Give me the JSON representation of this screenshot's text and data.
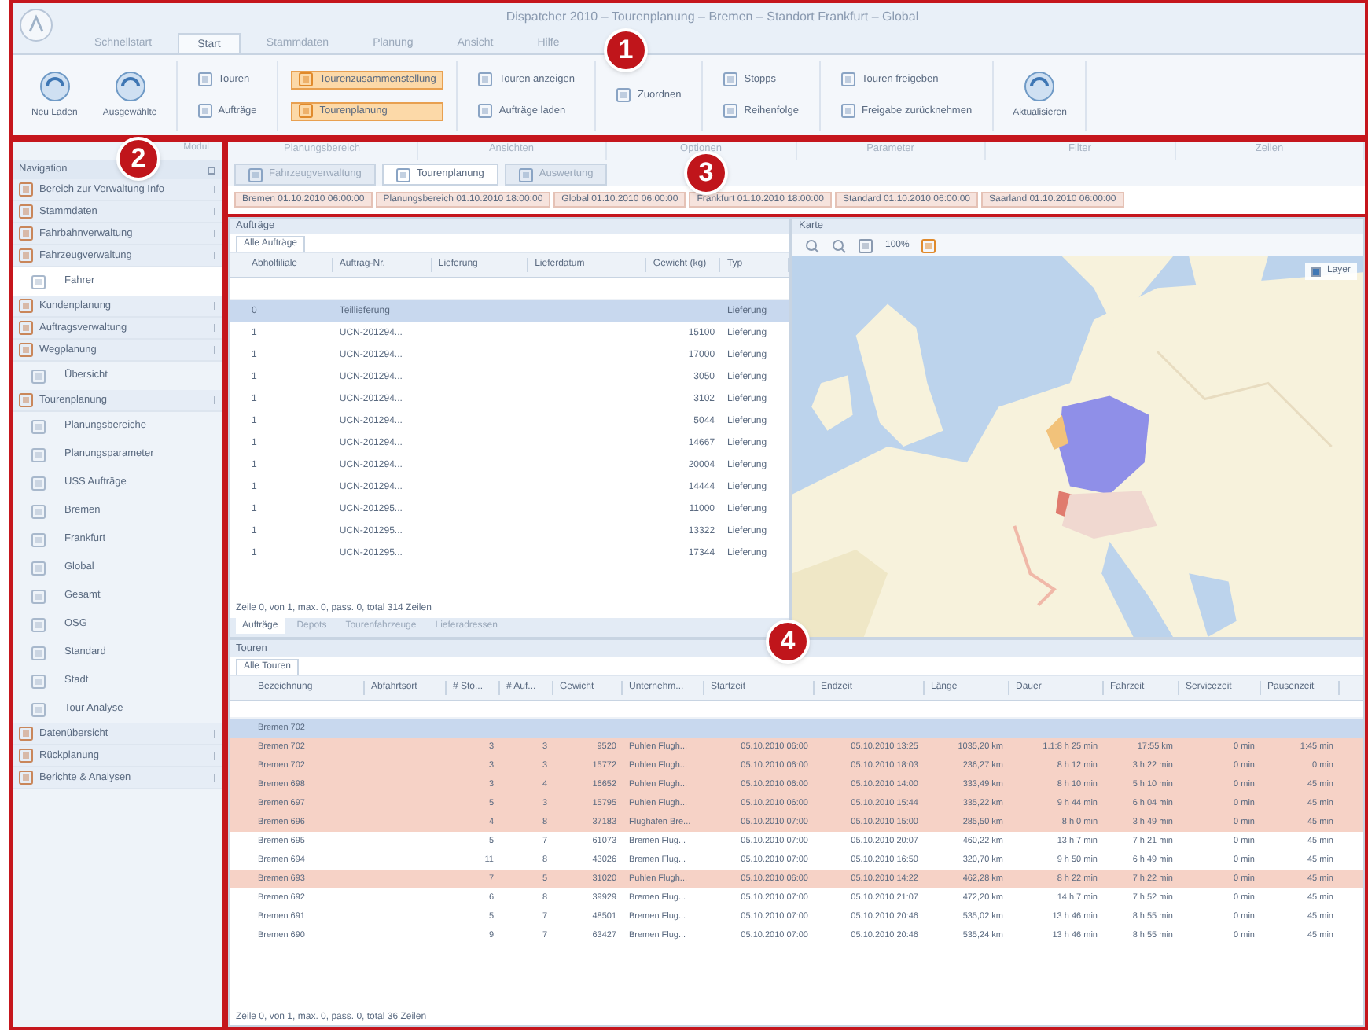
{
  "window": {
    "title": "Dispatcher 2010 – Tourenplanung – Bremen – Standort Frankfurt – Global"
  },
  "ribbon": {
    "marker": "1",
    "tabs": [
      {
        "label": "Schnellstart",
        "selected": false
      },
      {
        "label": "Start",
        "selected": true
      },
      {
        "label": "Stammdaten",
        "selected": false
      },
      {
        "label": "Planung",
        "selected": false
      },
      {
        "label": "Ansicht",
        "selected": false
      },
      {
        "label": "Hilfe",
        "selected": false
      }
    ],
    "groups": [
      {
        "items": [
          {
            "label": "Neu Laden",
            "kind": "large"
          },
          {
            "label": "Ausgewählte",
            "kind": "large"
          }
        ]
      },
      {
        "items": [
          {
            "label": "Touren",
            "kind": "small",
            "highlighted": false
          },
          {
            "label": "Aufträge",
            "kind": "small",
            "highlighted": false
          }
        ]
      },
      {
        "items": [
          {
            "label": "Tourenzusammenstellung",
            "kind": "small",
            "highlighted": true
          },
          {
            "label": "Tourenplanung",
            "kind": "small",
            "highlighted": true
          }
        ]
      },
      {
        "items": [
          {
            "label": "Touren anzeigen",
            "kind": "small",
            "highlighted": false
          },
          {
            "label": "Aufträge laden",
            "kind": "small",
            "highlighted": false
          }
        ]
      },
      {
        "items": [
          {
            "label": "Zuordnen",
            "kind": "small",
            "highlighted": false
          }
        ]
      },
      {
        "items": [
          {
            "label": "Stopps",
            "kind": "small",
            "highlighted": false
          },
          {
            "label": "Reihenfolge",
            "kind": "small",
            "highlighted": false
          }
        ]
      },
      {
        "items": [
          {
            "label": "Touren freigeben",
            "kind": "small",
            "highlighted": false
          },
          {
            "label": "Freigabe zurücknehmen",
            "kind": "small",
            "highlighted": false
          }
        ]
      },
      {
        "items": [
          {
            "label": "Aktualisieren",
            "kind": "large"
          }
        ]
      }
    ]
  },
  "navigation": {
    "marker": "2",
    "header": "Modul",
    "title": "Navigation",
    "items": [
      {
        "label": "Bereich zur Verwaltung Info",
        "kind": "section",
        "selected": false
      },
      {
        "label": "Stammdaten",
        "kind": "section",
        "selected": false
      },
      {
        "label": "Fahrbahnverwaltung",
        "kind": "section",
        "selected": false
      },
      {
        "label": "Fahrzeugverwaltung",
        "kind": "section",
        "selected": false
      },
      {
        "label": "Fahrer",
        "kind": "item",
        "selected": true
      },
      {
        "label": "Kundenplanung",
        "kind": "section",
        "selected": false
      },
      {
        "label": "Auftragsverwaltung",
        "kind": "section",
        "selected": false
      },
      {
        "label": "Wegplanung",
        "kind": "section",
        "selected": false
      },
      {
        "label": "Übersicht",
        "kind": "item",
        "selected": false
      },
      {
        "label": "Tourenplanung",
        "kind": "section",
        "selected": false
      },
      {
        "label": "Planungsbereiche",
        "kind": "item",
        "selected": false
      },
      {
        "label": "Planungsparameter",
        "kind": "item",
        "selected": false
      },
      {
        "label": "USS Aufträge",
        "kind": "item",
        "selected": false
      },
      {
        "label": "Bremen",
        "kind": "item",
        "selected": false
      },
      {
        "label": "Frankfurt",
        "kind": "item",
        "selected": false
      },
      {
        "label": "Global",
        "kind": "item",
        "selected": false
      },
      {
        "label": "Gesamt",
        "kind": "item",
        "selected": false
      },
      {
        "label": "OSG",
        "kind": "item",
        "selected": false
      },
      {
        "label": "Standard",
        "kind": "item",
        "selected": false
      },
      {
        "label": "Stadt",
        "kind": "item",
        "selected": false
      },
      {
        "label": "Tour Analyse",
        "kind": "item",
        "selected": false
      },
      {
        "label": "Datenübersicht",
        "kind": "section",
        "selected": false
      },
      {
        "label": "Rückplanung",
        "kind": "section",
        "selected": false
      },
      {
        "label": "Berichte & Analysen",
        "kind": "section",
        "selected": false
      }
    ]
  },
  "workspace": {
    "marker": "3",
    "groups": [
      "Planungsbereich",
      "Ansichten",
      "Optionen",
      "Parameter",
      "Filter",
      "Zeilen"
    ],
    "doc_tabs": [
      {
        "label": "Fahrzeugverwaltung",
        "selected": false
      },
      {
        "label": "Tourenplanung",
        "selected": true
      },
      {
        "label": "Auswertung",
        "selected": false
      }
    ],
    "filters": [
      "Bremen 01.10.2010 06:00:00",
      "Planungsbereich 01.10.2010 18:00:00",
      "Global 01.10.2010 06:00:00",
      "Frankfurt 01.10.2010 18:00:00",
      "Standard 01.10.2010 06:00:00",
      "Saarland 01.10.2010 06:00:00"
    ]
  },
  "panels_marker": "4",
  "orders_panel": {
    "title": "Aufträge",
    "filter_tab": "Alle Aufträge",
    "columns": [
      "Abholfiliale",
      "Auftrag-Nr.",
      "Lieferung",
      "Lieferdatum",
      "Gewicht (kg)",
      "Typ"
    ],
    "rows": [
      {
        "cells": [
          "0",
          "Teillieferung",
          "",
          "",
          "",
          "Lieferung"
        ],
        "selected": true
      },
      {
        "cells": [
          "1",
          "UCN-201294...",
          "",
          "",
          "15100",
          "Lieferung"
        ],
        "selected": false
      },
      {
        "cells": [
          "1",
          "UCN-201294...",
          "",
          "",
          "17000",
          "Lieferung"
        ],
        "selected": false
      },
      {
        "cells": [
          "1",
          "UCN-201294...",
          "",
          "",
          "3050",
          "Lieferung"
        ],
        "selected": false
      },
      {
        "cells": [
          "1",
          "UCN-201294...",
          "",
          "",
          "3102",
          "Lieferung"
        ],
        "selected": false
      },
      {
        "cells": [
          "1",
          "UCN-201294...",
          "",
          "",
          "5044",
          "Lieferung"
        ],
        "selected": false
      },
      {
        "cells": [
          "1",
          "UCN-201294...",
          "",
          "",
          "14667",
          "Lieferung"
        ],
        "selected": false
      },
      {
        "cells": [
          "1",
          "UCN-201294...",
          "",
          "",
          "20004",
          "Lieferung"
        ],
        "selected": false
      },
      {
        "cells": [
          "1",
          "UCN-201294...",
          "",
          "",
          "14444",
          "Lieferung"
        ],
        "selected": false
      },
      {
        "cells": [
          "1",
          "UCN-201295...",
          "",
          "",
          "11000",
          "Lieferung"
        ],
        "selected": false
      },
      {
        "cells": [
          "1",
          "UCN-201295...",
          "",
          "",
          "13322",
          "Lieferung"
        ],
        "selected": false
      },
      {
        "cells": [
          "1",
          "UCN-201295...",
          "",
          "",
          "17344",
          "Lieferung"
        ],
        "selected": false
      }
    ],
    "footer": "Zeile 0, von 1, max. 0, pass. 0, total 314 Zeilen",
    "bottom_tabs": [
      {
        "label": "Aufträge",
        "selected": true
      },
      {
        "label": "Depots",
        "selected": false
      },
      {
        "label": "Tourenfahrzeuge",
        "selected": false
      },
      {
        "label": "Lieferadressen",
        "selected": false
      }
    ]
  },
  "map_panel": {
    "title": "Karte",
    "zoom_label": "100%",
    "layer_toggle": {
      "label": "Layer",
      "checked": true
    }
  },
  "tours_panel": {
    "title": "Touren",
    "filter_tab": "Alle Touren",
    "columns": [
      "Bezeichnung",
      "Abfahrtsort",
      "# Sto...",
      "# Auf...",
      "Gewicht",
      "Unternehm...",
      "Startzeit",
      "Endzeit",
      "Länge",
      "Dauer",
      "Fahrzeit",
      "Servicezeit",
      "Pausenzeit"
    ],
    "rows": [
      {
        "cells": [
          "Bremen 702",
          "",
          "",
          "",
          "",
          "",
          "",
          "",
          "",
          "",
          "",
          "",
          ""
        ],
        "kind": "group"
      },
      {
        "cells": [
          "Bremen 702",
          "",
          "3",
          "3",
          "9520",
          "Puhlen Flugh...",
          "05.10.2010 06:00",
          "05.10.2010 13:25",
          "1035,20 km",
          "1.1:8 h 25 min",
          "17:55 km",
          "0 min",
          "1:45 min"
        ],
        "kind": "highlight"
      },
      {
        "cells": [
          "Bremen 702",
          "",
          "3",
          "3",
          "15772",
          "Puhlen Flugh...",
          "05.10.2010 06:00",
          "05.10.2010 18:03",
          "236,27 km",
          "8 h 12 min",
          "3 h 22 min",
          "0 min",
          "0 min"
        ],
        "kind": "highlight"
      },
      {
        "cells": [
          "Bremen 698",
          "",
          "3",
          "4",
          "16652",
          "Puhlen Flugh...",
          "05.10.2010 06:00",
          "05.10.2010 14:00",
          "333,49 km",
          "8 h 10 min",
          "5 h 10 min",
          "0 min",
          "45 min"
        ],
        "kind": "highlight"
      },
      {
        "cells": [
          "Bremen 697",
          "",
          "5",
          "3",
          "15795",
          "Puhlen Flugh...",
          "05.10.2010 06:00",
          "05.10.2010 15:44",
          "335,22 km",
          "9 h 44 min",
          "6 h 04 min",
          "0 min",
          "45 min"
        ],
        "kind": "highlight"
      },
      {
        "cells": [
          "Bremen 696",
          "",
          "4",
          "8",
          "37183",
          "Flughafen Bre...",
          "05.10.2010 07:00",
          "05.10.2010 15:00",
          "285,50 km",
          "8 h 0 min",
          "3 h 49 min",
          "0 min",
          "45 min"
        ],
        "kind": "highlight"
      },
      {
        "cells": [
          "Bremen 695",
          "",
          "5",
          "7",
          "61073",
          "Bremen Flug...",
          "05.10.2010 07:00",
          "05.10.2010 20:07",
          "460,22 km",
          "13 h 7 min",
          "7 h 21 min",
          "0 min",
          "45 min"
        ],
        "kind": "normal"
      },
      {
        "cells": [
          "Bremen 694",
          "",
          "11",
          "8",
          "43026",
          "Bremen Flug...",
          "05.10.2010 07:00",
          "05.10.2010 16:50",
          "320,70 km",
          "9 h 50 min",
          "6 h 49 min",
          "0 min",
          "45 min"
        ],
        "kind": "normal"
      },
      {
        "cells": [
          "Bremen 693",
          "",
          "7",
          "5",
          "31020",
          "Puhlen Flugh...",
          "05.10.2010 06:00",
          "05.10.2010 14:22",
          "462,28 km",
          "8 h 22 min",
          "7 h 22 min",
          "0 min",
          "45 min"
        ],
        "kind": "highlight"
      },
      {
        "cells": [
          "Bremen 692",
          "",
          "6",
          "8",
          "39929",
          "Bremen Flug...",
          "05.10.2010 07:00",
          "05.10.2010 21:07",
          "472,20 km",
          "14 h 7 min",
          "7 h 52 min",
          "0 min",
          "45 min"
        ],
        "kind": "normal"
      },
      {
        "cells": [
          "Bremen 691",
          "",
          "5",
          "7",
          "48501",
          "Bremen Flug...",
          "05.10.2010 07:00",
          "05.10.2010 20:46",
          "535,02 km",
          "13 h 46 min",
          "8 h 55 min",
          "0 min",
          "45 min"
        ],
        "kind": "normal"
      },
      {
        "cells": [
          "Bremen 690",
          "",
          "9",
          "7",
          "63427",
          "Bremen Flug...",
          "05.10.2010 07:00",
          "05.10.2010 20:46",
          "535,24 km",
          "13 h 46 min",
          "8 h 55 min",
          "0 min",
          "45 min"
        ],
        "kind": "normal"
      }
    ],
    "footer": "Zeile 0, von 1, max. 0, pass. 0, total 36 Zeilen"
  }
}
